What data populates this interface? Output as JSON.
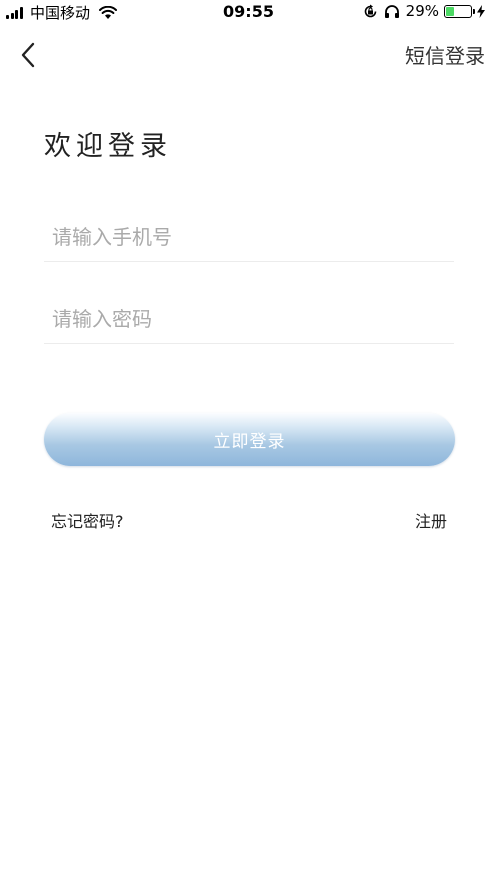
{
  "status_bar": {
    "carrier": "中国移动",
    "time": "09:55",
    "battery_percent": "29%",
    "battery_level": 0.29,
    "icons": [
      "signal-icon",
      "wifi-icon",
      "rotation-lock-icon",
      "headphones-icon",
      "battery-icon",
      "charging-icon"
    ]
  },
  "nav": {
    "back_icon": "chevron-left-icon",
    "sms_login_label": "短信登录"
  },
  "welcome_title": "欢迎登录",
  "form": {
    "phone_placeholder": "请输入手机号",
    "phone_value": "",
    "password_placeholder": "请输入密码",
    "password_value": ""
  },
  "login_button_label": "立即登录",
  "links": {
    "forgot_password": "忘记密码?",
    "register": "注册"
  },
  "colors": {
    "button_gradient_top": "#fbfdff",
    "button_gradient_bottom": "#8eb6db",
    "battery_fill": "#4cd964",
    "placeholder": "#aaaaaa"
  }
}
